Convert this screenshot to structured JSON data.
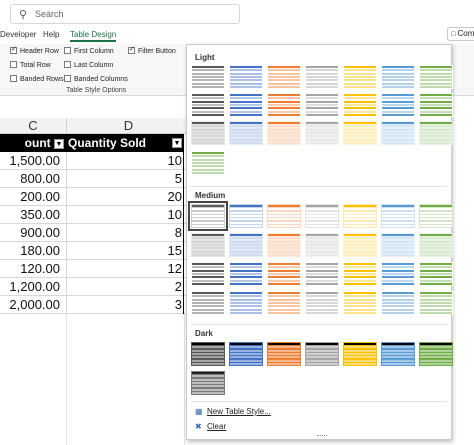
{
  "search": {
    "placeholder": "Search"
  },
  "tabs": [
    {
      "label": "Developer",
      "active": false
    },
    {
      "label": "Help",
      "active": false
    },
    {
      "label": "Table Design",
      "active": true
    }
  ],
  "comments_label": "Com",
  "style_options": {
    "group_label": "Table Style Options",
    "items": [
      {
        "label": "Header Row",
        "checked": true
      },
      {
        "label": "Total Row",
        "checked": false
      },
      {
        "label": "Banded Rows",
        "checked": false
      },
      {
        "label": "First Column",
        "checked": false
      },
      {
        "label": "Last Column",
        "checked": false
      },
      {
        "label": "Banded Columns",
        "checked": false
      },
      {
        "label": "Filter Button",
        "checked": true
      }
    ]
  },
  "sheet": {
    "columns": [
      "C",
      "D"
    ],
    "headers": [
      "ount",
      "Quantity Sold"
    ],
    "rows": [
      {
        "amount": "1,500.00",
        "qty": "10"
      },
      {
        "amount": "800.00",
        "qty": "5"
      },
      {
        "amount": "200.00",
        "qty": "20"
      },
      {
        "amount": "350.00",
        "qty": "10"
      },
      {
        "amount": "900.00",
        "qty": "8"
      },
      {
        "amount": "180.00",
        "qty": "15"
      },
      {
        "amount": "120.00",
        "qty": "12"
      },
      {
        "amount": "1,200.00",
        "qty": "2"
      },
      {
        "amount": "2,000.00",
        "qty": "3"
      }
    ]
  },
  "gallery": {
    "sections": [
      "Light",
      "Medium",
      "Dark"
    ],
    "commands": [
      {
        "label": "New Table Style...",
        "icon": "new-style-icon"
      },
      {
        "label": "Clear",
        "icon": "clear-icon"
      }
    ],
    "palette": [
      "#595959",
      "#4472c4",
      "#ed7d31",
      "#a5a5a5",
      "#ffc000",
      "#5b9bd5",
      "#70ad47"
    ]
  }
}
